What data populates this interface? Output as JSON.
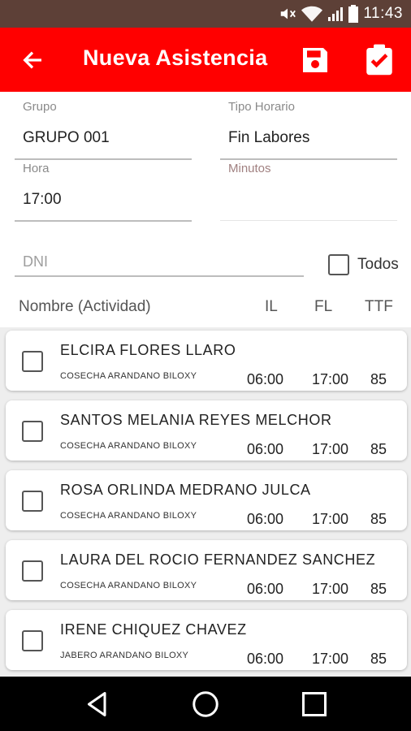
{
  "status_bar": {
    "time": "11:43",
    "icons": [
      "mute-icon",
      "wifi-icon",
      "signal-icon",
      "battery-icon"
    ]
  },
  "app_bar": {
    "title": "Nueva Asistencia",
    "icons": [
      "back-arrow-icon",
      "save-icon",
      "clipboard-check-icon"
    ],
    "color": "#ff0000"
  },
  "form": {
    "grupo": {
      "label": "Grupo",
      "value": "GRUPO 001"
    },
    "tipo_horario": {
      "label": "Tipo Horario",
      "value": "Fin Labores"
    },
    "hora": {
      "label": "Hora",
      "value": "17:00"
    },
    "minutos": {
      "label": "Minutos",
      "value": ""
    },
    "dni": {
      "placeholder": "DNI"
    },
    "todos_label": "Todos"
  },
  "table": {
    "columns": {
      "nombre": "Nombre  (Actividad)",
      "il": "IL",
      "fl": "FL",
      "ttf": "TTF"
    },
    "rows": [
      {
        "nombre": "ELCIRA FLORES LLARO",
        "actividad": "COSECHA  ARANDANO BILOXY",
        "il": "06:00",
        "fl": "17:00",
        "ttf": "85"
      },
      {
        "nombre": "SANTOS MELANIA REYES MELCHOR",
        "actividad": "COSECHA  ARANDANO BILOXY",
        "il": "06:00",
        "fl": "17:00",
        "ttf": "85"
      },
      {
        "nombre": "ROSA ORLINDA MEDRANO JULCA",
        "actividad": "COSECHA  ARANDANO BILOXY",
        "il": "06:00",
        "fl": "17:00",
        "ttf": "85"
      },
      {
        "nombre": "LAURA DEL ROCIO FERNANDEZ SANCHEZ",
        "actividad": "COSECHA  ARANDANO BILOXY",
        "il": "06:00",
        "fl": "17:00",
        "ttf": "85"
      },
      {
        "nombre": "IRENE CHIQUEZ CHAVEZ",
        "actividad": "JABERO ARANDANO BILOXY",
        "il": "06:00",
        "fl": "17:00",
        "ttf": "85"
      }
    ]
  },
  "nav_bar": {
    "icons": [
      "back-triangle-icon",
      "home-circle-icon",
      "recents-square-icon"
    ]
  }
}
